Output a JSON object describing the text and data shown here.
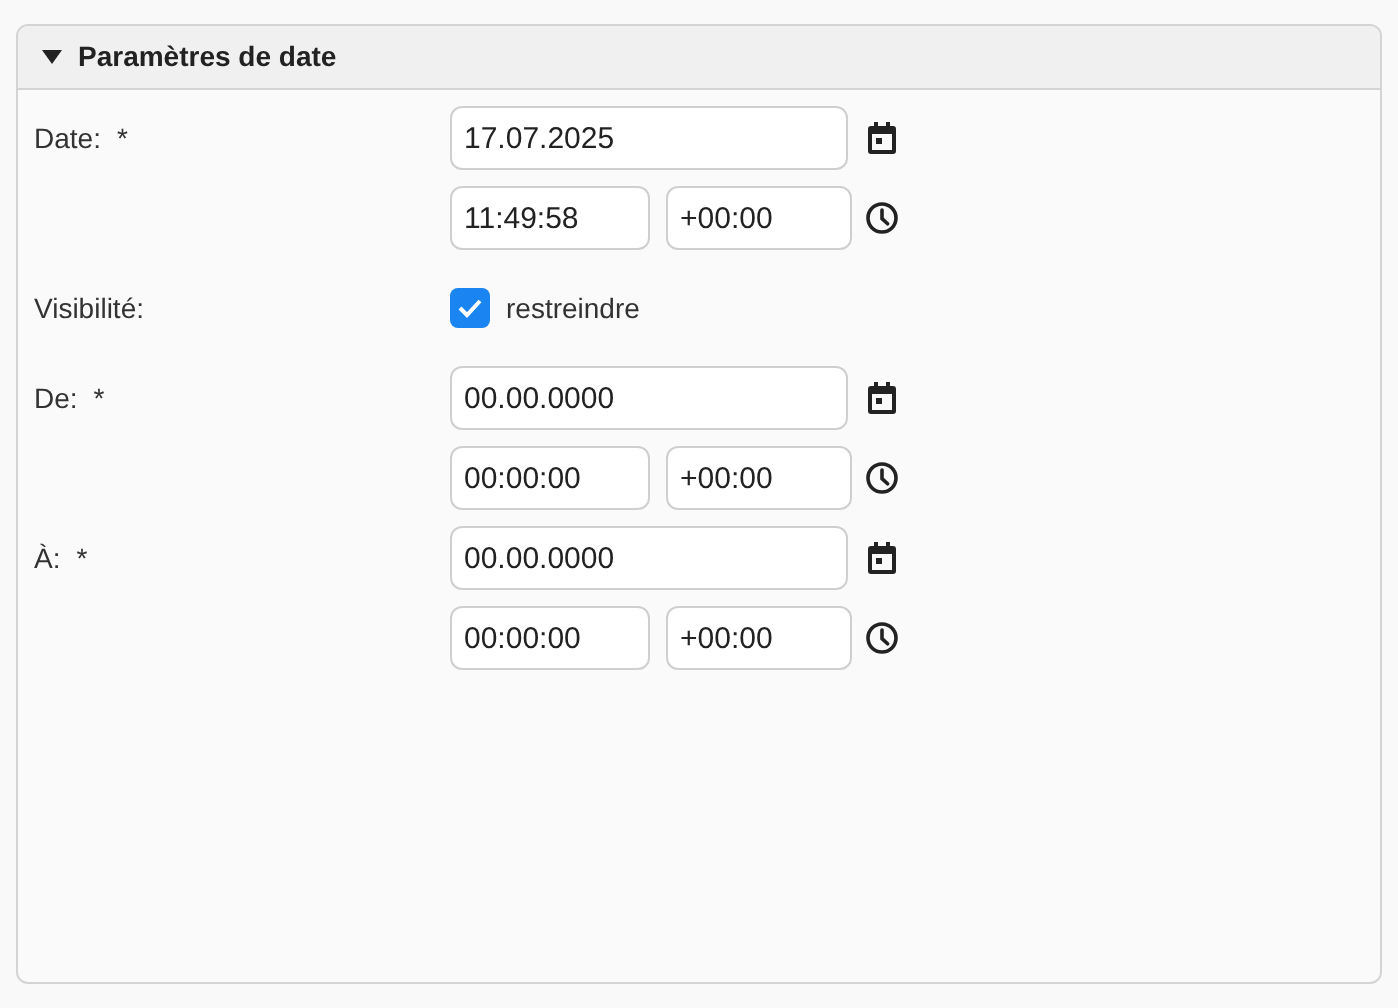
{
  "section": {
    "title": "Paramètres de date",
    "expanded": true
  },
  "fields": [
    {
      "kind": "datetime",
      "label": "Date:",
      "required_mark": "*",
      "date": "17.07.2025",
      "time": "11:49:58",
      "offset": "+00:00"
    },
    {
      "kind": "checkbox",
      "label": "Visibilité:",
      "checked": true,
      "option": "restreindre"
    },
    {
      "kind": "datetime",
      "label": "De:",
      "required_mark": "*",
      "date": "00.00.0000",
      "time": "00:00:00",
      "offset": "+00:00"
    },
    {
      "kind": "datetime",
      "label": "À:",
      "required_mark": "*",
      "date": "00.00.0000",
      "time": "00:00:00",
      "offset": "+00:00"
    }
  ]
}
